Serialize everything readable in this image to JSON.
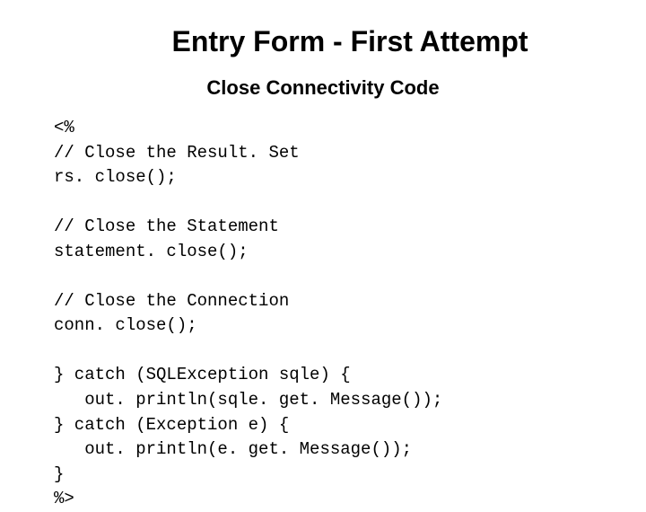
{
  "title": "Entry Form - First Attempt",
  "subtitle": "Close Connectivity Code",
  "code": "<%\n// Close the Result. Set\nrs. close();\n\n// Close the Statement\nstatement. close();\n\n// Close the Connection\nconn. close();\n\n} catch (SQLException sqle) {\n   out. println(sqle. get. Message());\n} catch (Exception e) {\n   out. println(e. get. Message());\n}\n%>"
}
